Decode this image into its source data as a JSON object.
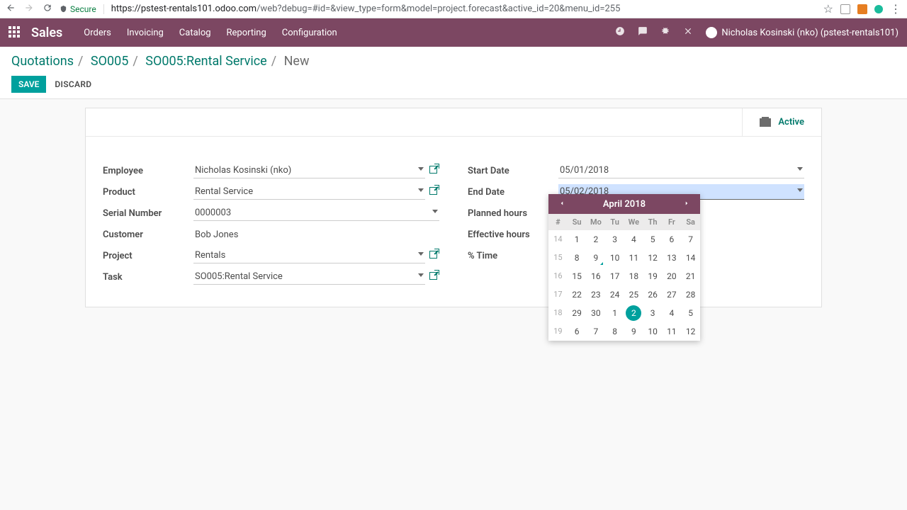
{
  "chrome": {
    "secure_label": "Secure",
    "url_host": "https://pstest-rentals101.odoo.com",
    "url_path": "/web?debug=#id=&view_type=form&model=project.forecast&active_id=20&menu_id=255"
  },
  "nav": {
    "brand": "Sales",
    "items": [
      "Orders",
      "Invoicing",
      "Catalog",
      "Reporting",
      "Configuration"
    ],
    "user": "Nicholas Kosinski (nko) (pstest-rentals101)"
  },
  "breadcrumb": {
    "items": [
      "Quotations",
      "SO005",
      "SO005:Rental Service"
    ],
    "current": "New"
  },
  "buttons": {
    "save": "SAVE",
    "discard": "DISCARD"
  },
  "status": {
    "active": "Active"
  },
  "form": {
    "left_labels": {
      "employee": "Employee",
      "product": "Product",
      "serial": "Serial Number",
      "customer": "Customer",
      "project": "Project",
      "task": "Task"
    },
    "right_labels": {
      "start": "Start Date",
      "end": "End Date",
      "planned": "Planned hours",
      "effective": "Effective hours",
      "pct": "% Time"
    },
    "values": {
      "employee": "Nicholas Kosinski (nko)",
      "product": "Rental Service",
      "serial": "0000003",
      "customer": "Bob Jones",
      "project": "Rentals",
      "task": "SO005:Rental Service",
      "start": "05/01/2018",
      "end": "05/02/2018"
    }
  },
  "datepicker": {
    "month": "April 2018",
    "day_headers": [
      "#",
      "Su",
      "Mo",
      "Tu",
      "We",
      "Th",
      "Fr",
      "Sa"
    ],
    "weeks": [
      {
        "wk": "14",
        "days": [
          "1",
          "2",
          "3",
          "4",
          "5",
          "6",
          "7"
        ]
      },
      {
        "wk": "15",
        "days": [
          "8",
          "9",
          "10",
          "11",
          "12",
          "13",
          "14"
        ],
        "today_idx": 1
      },
      {
        "wk": "16",
        "days": [
          "15",
          "16",
          "17",
          "18",
          "19",
          "20",
          "21"
        ]
      },
      {
        "wk": "17",
        "days": [
          "22",
          "23",
          "24",
          "25",
          "26",
          "27",
          "28"
        ]
      },
      {
        "wk": "18",
        "days": [
          "29",
          "30",
          "1",
          "2",
          "3",
          "4",
          "5"
        ],
        "selected_idx": 3
      },
      {
        "wk": "19",
        "days": [
          "6",
          "7",
          "8",
          "9",
          "10",
          "11",
          "12"
        ]
      }
    ]
  }
}
